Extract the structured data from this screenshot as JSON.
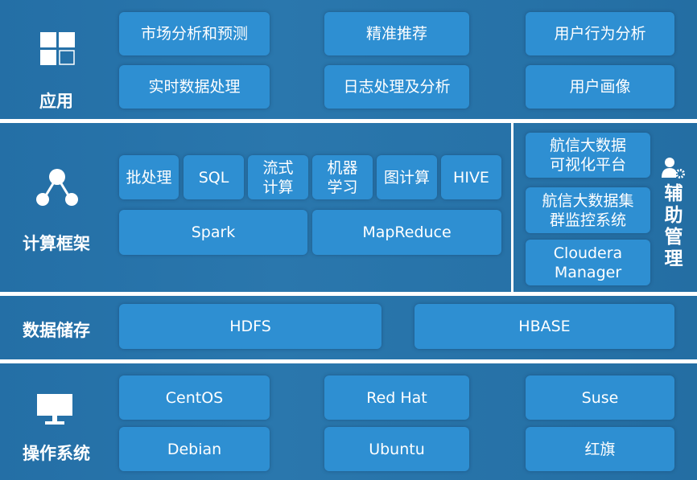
{
  "application": {
    "label": "应用",
    "icon": "grid-icon",
    "items": [
      "市场分析和预测",
      "精准推荐",
      "用户行为分析",
      "实时数据处理",
      "日志处理及分析",
      "用户画像"
    ]
  },
  "compute": {
    "label": "计算框架",
    "icon": "network-nodes-icon",
    "items": [
      "批处理",
      "SQL",
      "流式\n计算",
      "机器\n学习",
      "图计算",
      "HIVE"
    ],
    "engines": [
      "Spark",
      "MapReduce"
    ]
  },
  "management": {
    "label": "辅助管理",
    "icon": "user-gear-icon",
    "items": [
      "航信大数据\n可视化平台",
      "航信大数据集\n群监控系统",
      "Cloudera\nManager"
    ]
  },
  "storage": {
    "label": "数据储存",
    "items": [
      "HDFS",
      "HBASE"
    ]
  },
  "os": {
    "label": "操作系统",
    "icon": "monitor-icon",
    "items": [
      "CentOS",
      "Red Hat",
      "Suse",
      "Debian",
      "Ubuntu",
      "红旗"
    ]
  },
  "colors": {
    "background": "#2670a6",
    "box": "#2e8fd2",
    "divider": "#ffffff"
  }
}
